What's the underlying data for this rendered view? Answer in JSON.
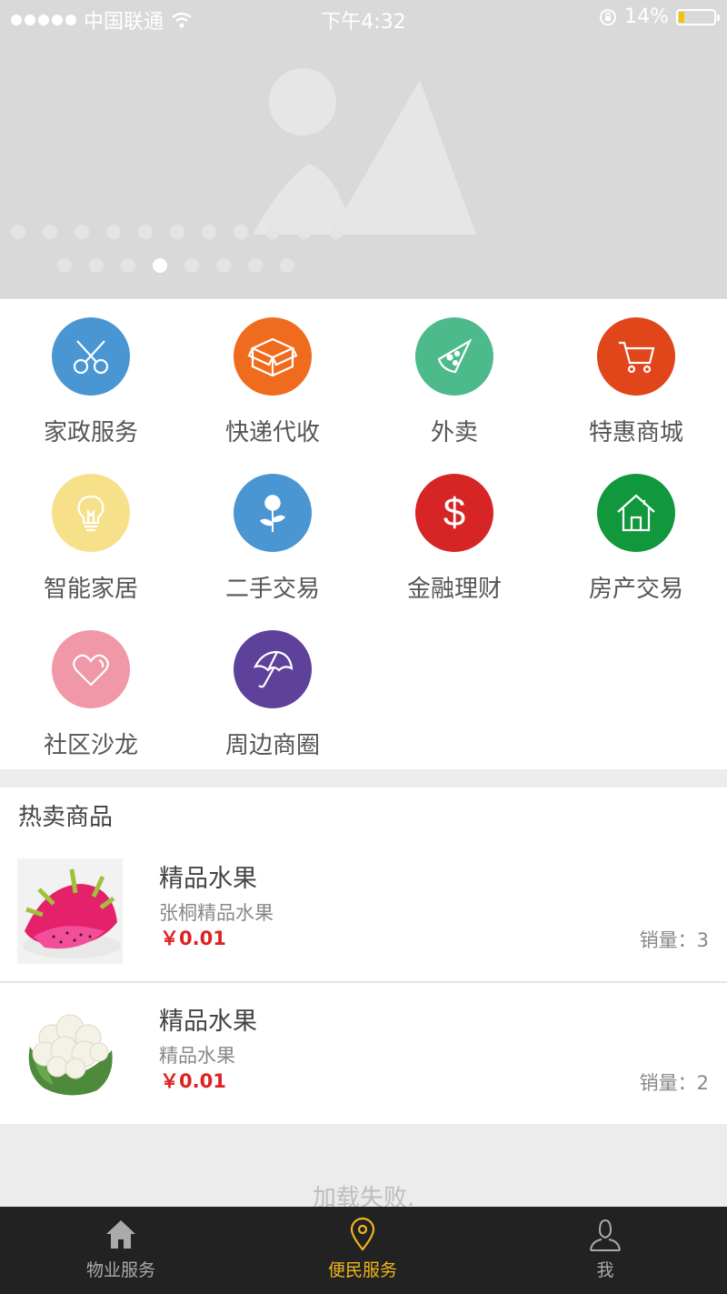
{
  "status_bar": {
    "carrier": "中国联通",
    "time": "下午4:32",
    "battery": "14%"
  },
  "banner": {
    "image_icon": "image-placeholder-icon",
    "page_indicator_active": 4
  },
  "services": [
    {
      "label": "家政服务",
      "icon": "scissors-icon",
      "color": "#4a96d2"
    },
    {
      "label": "快递代收",
      "icon": "package-icon",
      "color": "#ef6c1e"
    },
    {
      "label": "外卖",
      "icon": "pizza-icon",
      "color": "#4dba8c"
    },
    {
      "label": "特惠商城",
      "icon": "cart-icon",
      "color": "#e0461a"
    },
    {
      "label": "智能家居",
      "icon": "lightbulb-icon",
      "color": "#f7e08a"
    },
    {
      "label": "二手交易",
      "icon": "flower-icon",
      "color": "#4a96d2"
    },
    {
      "label": "金融理财",
      "icon": "dollar-icon",
      "color": "#d72424"
    },
    {
      "label": "房产交易",
      "icon": "house-icon",
      "color": "#11973c"
    },
    {
      "label": "社区沙龙",
      "icon": "heart-icon",
      "color": "#f097a8"
    },
    {
      "label": "周边商圈",
      "icon": "umbrella-icon",
      "color": "#5d419b"
    }
  ],
  "hot": {
    "title": "热卖商品",
    "items": [
      {
        "name": "精品水果",
        "shop": "张桐精品水果",
        "price": "￥0.01",
        "sales": "销量：3",
        "image": "dragon-fruit-image"
      },
      {
        "name": "精品水果",
        "shop": "精品水果",
        "price": "￥0.01",
        "sales": "销量：2",
        "image": "cauliflower-image"
      }
    ]
  },
  "load_status": "加载失败.",
  "tabbar": {
    "tabs": [
      {
        "label": "物业服务",
        "icon": "home-icon",
        "active": false
      },
      {
        "label": "便民服务",
        "icon": "location-pin-icon",
        "active": true
      },
      {
        "label": "我",
        "icon": "user-icon",
        "active": false
      }
    ],
    "active_color": "#f2b51c"
  }
}
